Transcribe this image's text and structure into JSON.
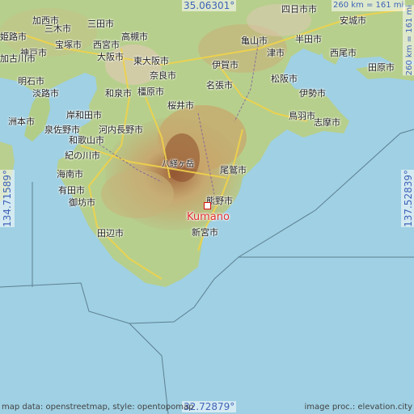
{
  "map": {
    "city": "Kumano",
    "coords": {
      "top_lon": "35.06301°",
      "bottom_lat": "32.72879°",
      "left_lon": "134.71589°",
      "right_lon": "137.52839°"
    },
    "scale": "260 km = 161 mi",
    "attribution_left": "map data: openstreetmap, style: opentopomap",
    "attribution_right": "image proc.: elevation.city",
    "colors": {
      "sea": "#9fd0e3",
      "accent": "#e03030",
      "coord": "#3f63b8"
    },
    "place_labels": [
      "加西市",
      "明石市",
      "淡路市",
      "洲本市",
      "紀の川市",
      "和歌山市",
      "海南市",
      "有田市",
      "御坊市",
      "田辺市",
      "岸和田市",
      "河内長野市",
      "泉佐野市",
      "奈良市",
      "桜井市",
      "名張市",
      "伊賀市",
      "亀山市",
      "津市",
      "松阪市",
      "伊勢市",
      "鳥羽市",
      "志摩市",
      "尾鷲市",
      "熊野市",
      "新宮市",
      "西尾市",
      "田原市",
      "半田市",
      "安城市",
      "四日市市",
      "神戸市",
      "三田市",
      "宝塚市",
      "大阪市",
      "東大阪市",
      "西宮市",
      "高槻市",
      "三木市",
      "姫路市",
      "加古川市",
      "橿原市",
      "和泉市",
      "八経ヶ岳"
    ]
  }
}
